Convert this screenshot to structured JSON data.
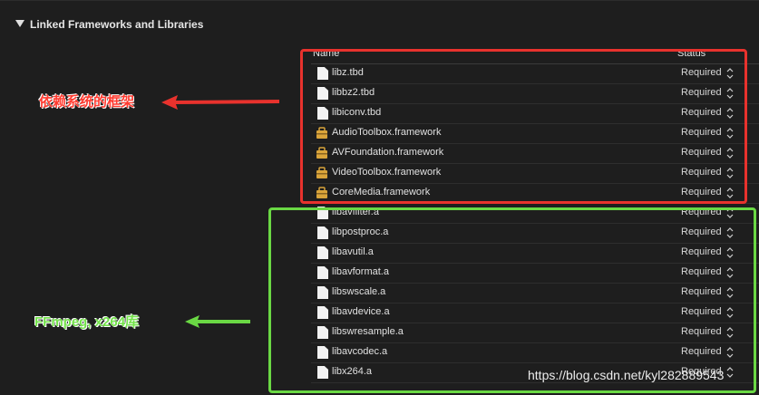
{
  "section": {
    "title": "Linked Frameworks and Libraries"
  },
  "table": {
    "headers": {
      "name": "Name",
      "status": "Status"
    },
    "rows": [
      {
        "name": "libz.tbd",
        "status": "Required",
        "icon": "file-icon"
      },
      {
        "name": "libbz2.tbd",
        "status": "Required",
        "icon": "file-icon"
      },
      {
        "name": "libiconv.tbd",
        "status": "Required",
        "icon": "file-icon"
      },
      {
        "name": "AudioToolbox.framework",
        "status": "Required",
        "icon": "framework-icon"
      },
      {
        "name": "AVFoundation.framework",
        "status": "Required",
        "icon": "framework-icon"
      },
      {
        "name": "VideoToolbox.framework",
        "status": "Required",
        "icon": "framework-icon"
      },
      {
        "name": "CoreMedia.framework",
        "status": "Required",
        "icon": "framework-icon"
      },
      {
        "name": "libavfilter.a",
        "status": "Required",
        "icon": "file-icon"
      },
      {
        "name": "libpostproc.a",
        "status": "Required",
        "icon": "file-icon"
      },
      {
        "name": "libavutil.a",
        "status": "Required",
        "icon": "file-icon"
      },
      {
        "name": "libavformat.a",
        "status": "Required",
        "icon": "file-icon"
      },
      {
        "name": "libswscale.a",
        "status": "Required",
        "icon": "file-icon"
      },
      {
        "name": "libavdevice.a",
        "status": "Required",
        "icon": "file-icon"
      },
      {
        "name": "libswresample.a",
        "status": "Required",
        "icon": "file-icon"
      },
      {
        "name": "libavcodec.a",
        "status": "Required",
        "icon": "file-icon"
      },
      {
        "name": "libx264.a",
        "status": "Required",
        "icon": "file-icon"
      }
    ]
  },
  "annotations": {
    "system_frameworks": "依赖系统的框架",
    "ffmpeg_libs": "FFmpeg, x264库"
  },
  "watermark": "https://blog.csdn.net/kyl282889543",
  "colors": {
    "background": "#1e1e1e",
    "red_annotation": "#e8322d",
    "green_annotation": "#6ad844",
    "framework_icon": "#d9a43a"
  }
}
